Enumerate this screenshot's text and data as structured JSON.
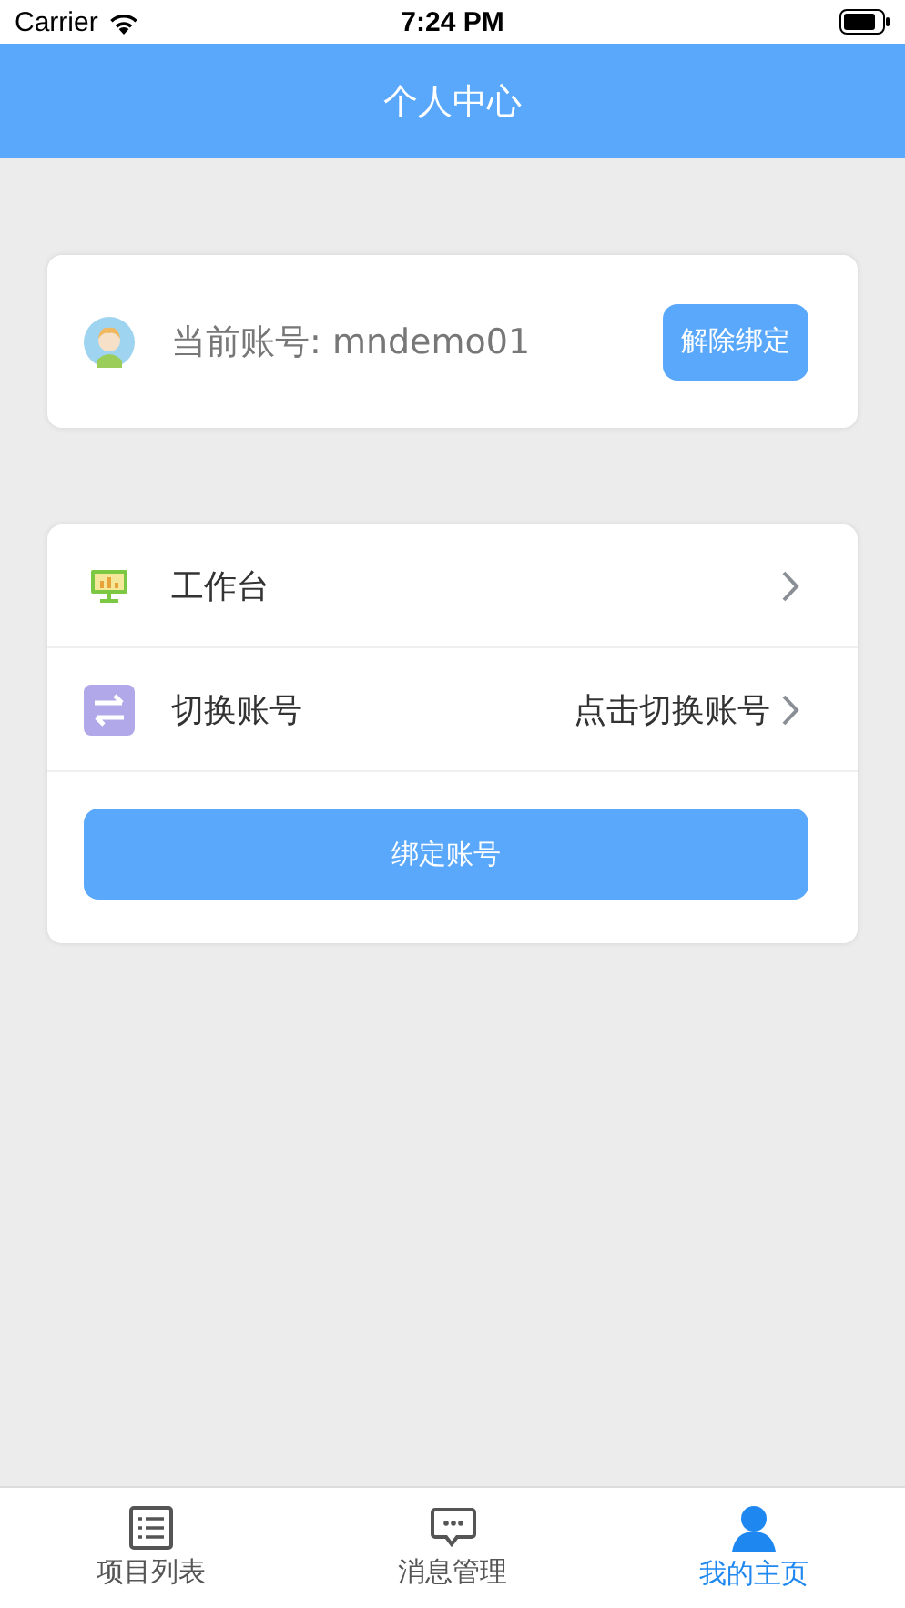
{
  "status_bar": {
    "carrier": "Carrier",
    "time": "7:24 PM"
  },
  "nav": {
    "title": "个人中心"
  },
  "account": {
    "label": "当前账号: mndemo01",
    "button": "解除绑定"
  },
  "menu": [
    {
      "label": "工作台"
    },
    {
      "label": "切换账号",
      "value": "点击切换账号"
    }
  ],
  "bind_button": "绑定账号",
  "tabs": [
    {
      "label": "项目列表",
      "selected": false
    },
    {
      "label": "消息管理",
      "selected": false
    },
    {
      "label": "我的主页",
      "selected": true
    }
  ]
}
